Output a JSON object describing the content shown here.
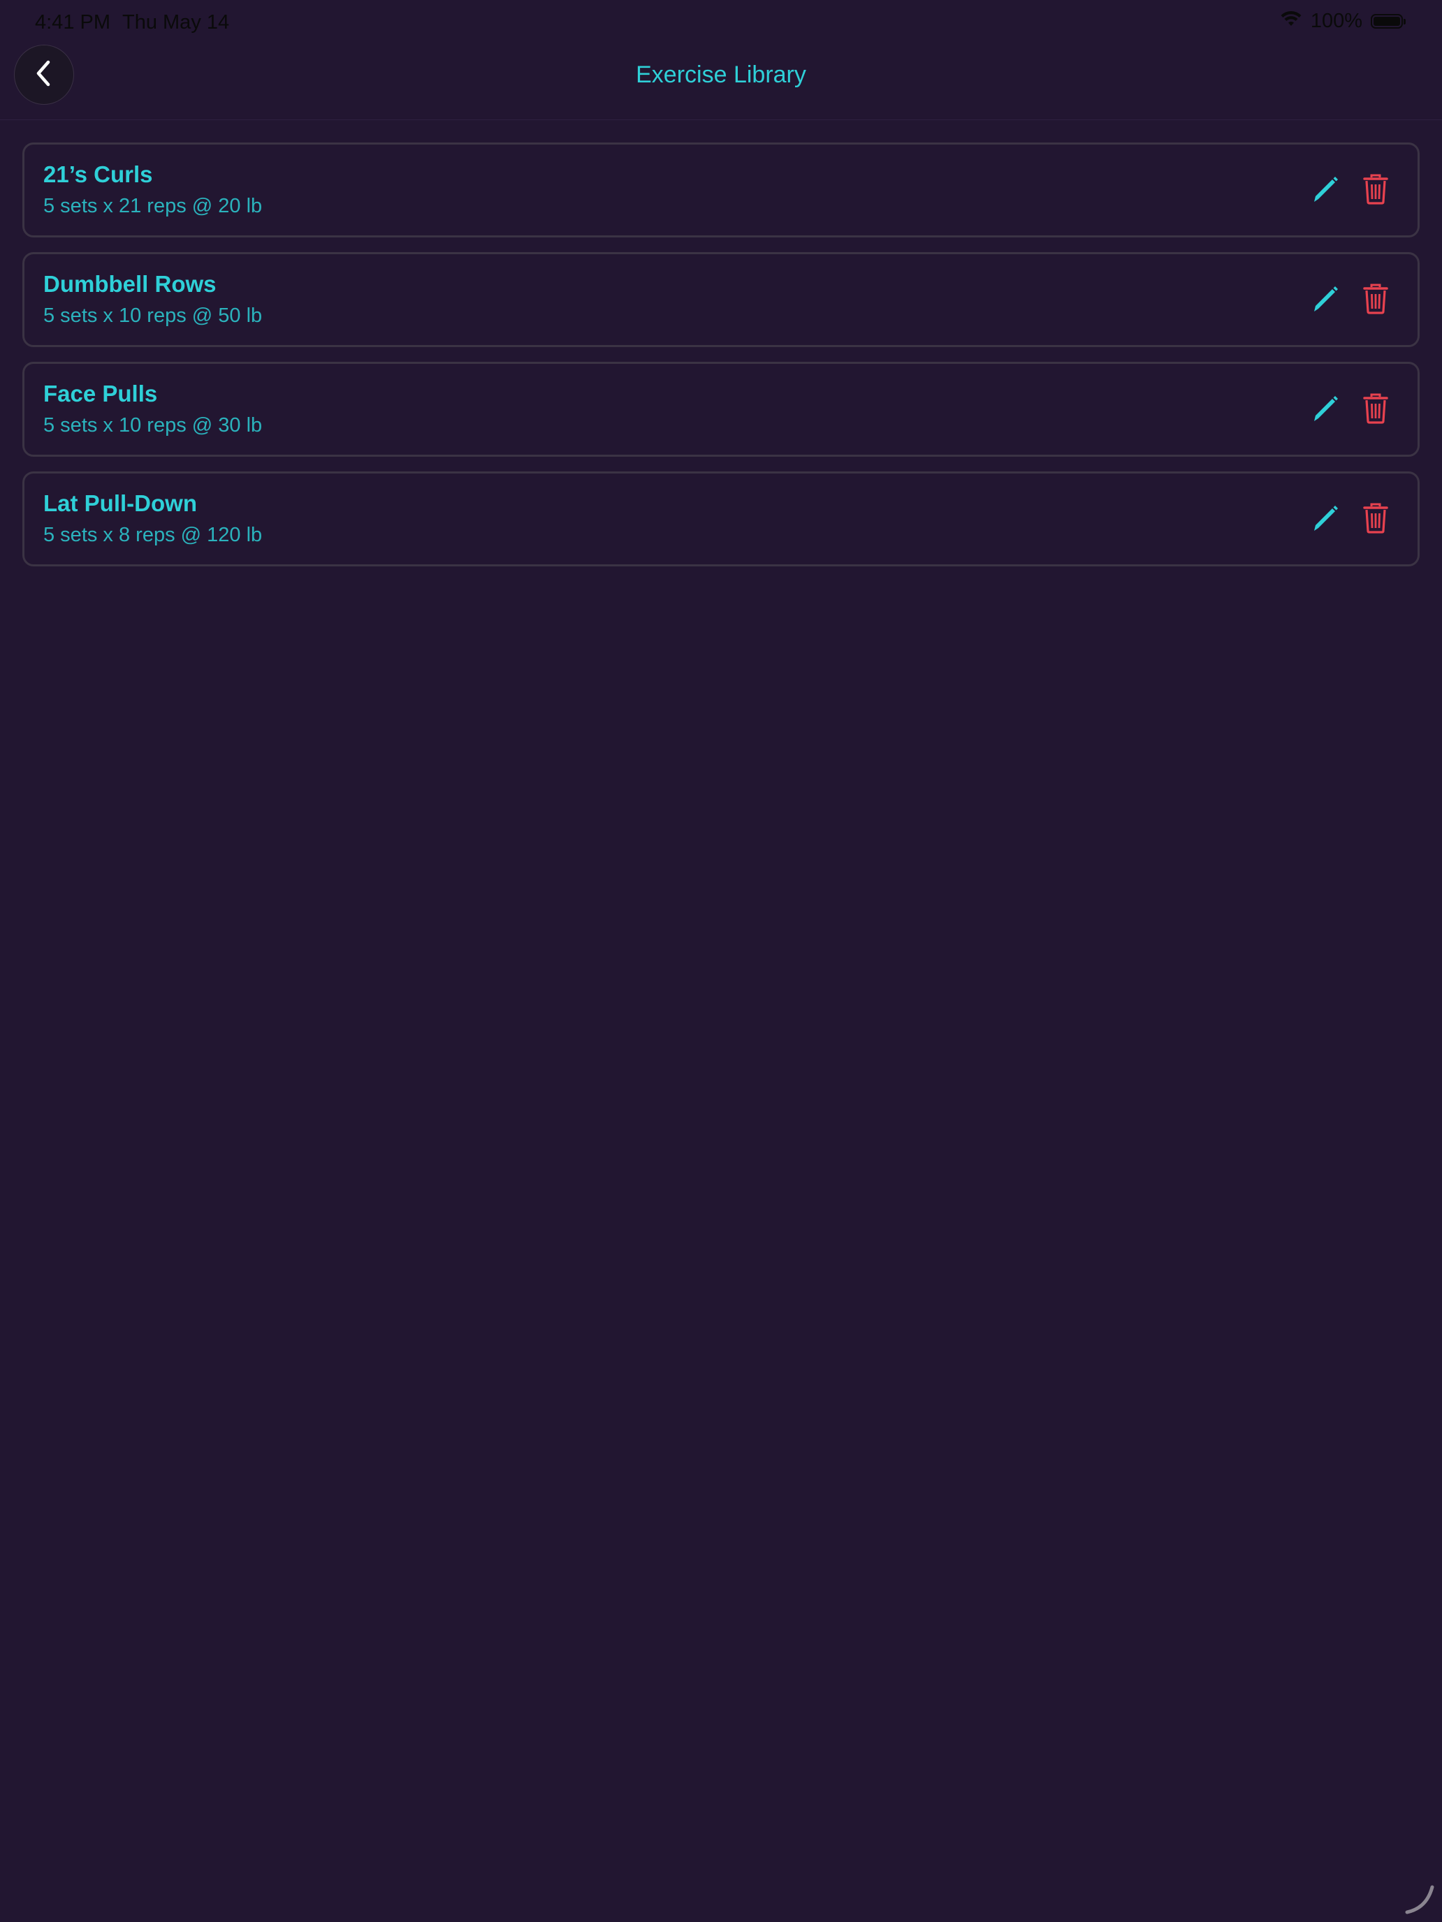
{
  "status_bar": {
    "time": "4:41 PM",
    "date": "Thu May 14",
    "battery": "100%"
  },
  "nav": {
    "title": "Exercise Library"
  },
  "exercises": [
    {
      "name": "21’s Curls",
      "detail": "5 sets x 21 reps @ 20 lb"
    },
    {
      "name": "Dumbbell Rows",
      "detail": "5 sets x 10 reps @ 50 lb"
    },
    {
      "name": "Face Pulls",
      "detail": "5 sets x 10 reps @ 30 lb"
    },
    {
      "name": "Lat Pull-Down",
      "detail": "5 sets x 8 reps @ 120 lb"
    }
  ],
  "icons": {
    "back": "chevron-left-icon",
    "edit": "pencil-icon",
    "delete": "trash-icon",
    "wifi": "wifi-icon",
    "battery": "battery-icon"
  },
  "colors": {
    "background": "#221631",
    "accent": "#2fd0d8",
    "delete": "#e8424f",
    "card_border": "#3b3344"
  }
}
